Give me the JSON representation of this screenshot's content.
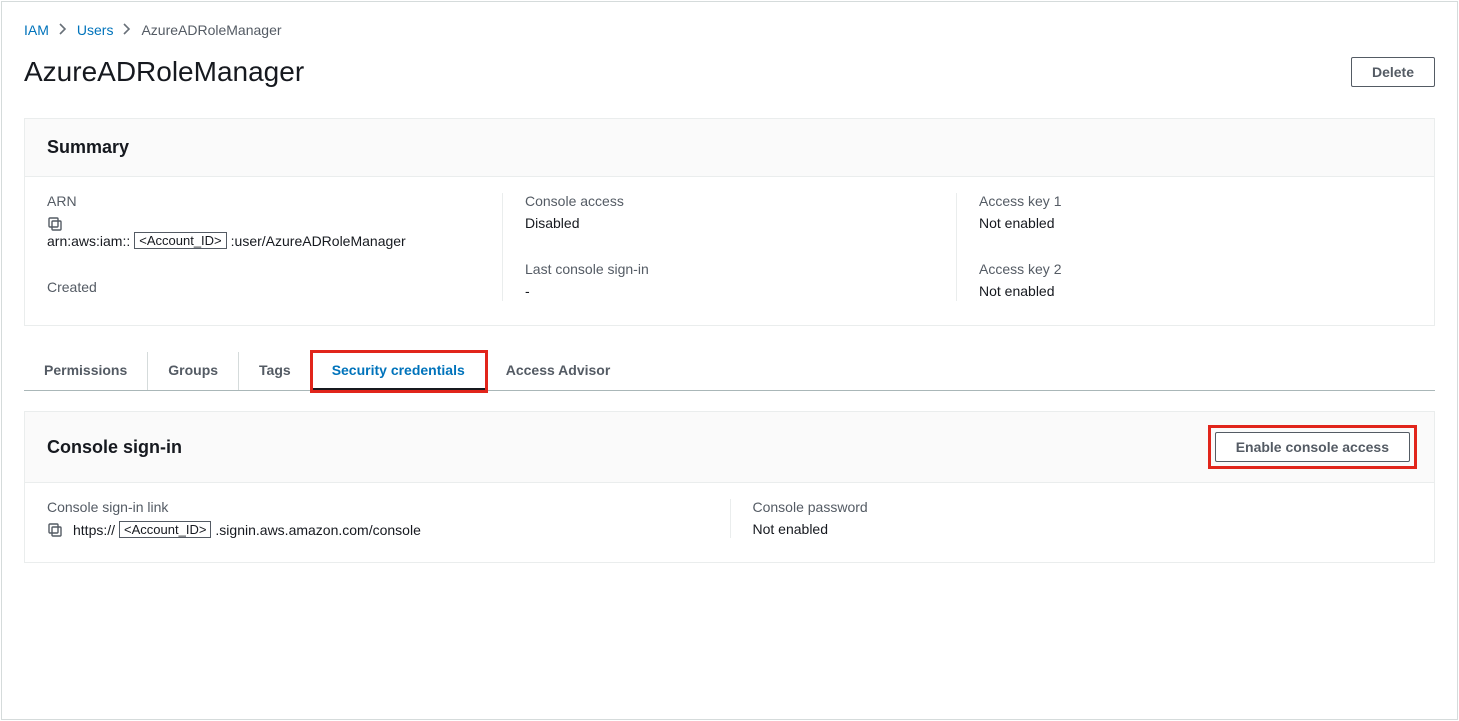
{
  "breadcrumb": {
    "root": "IAM",
    "mid": "Users",
    "current": "AzureADRoleManager"
  },
  "title": "AzureADRoleManager",
  "actions": {
    "delete": "Delete"
  },
  "summary": {
    "heading": "Summary",
    "arn_label": "ARN",
    "arn_prefix": "arn:aws:iam::",
    "arn_account_placeholder": "<Account_ID>",
    "arn_suffix": ":user/AzureADRoleManager",
    "created_label": "Created",
    "created_value": "",
    "console_access_label": "Console access",
    "console_access_value": "Disabled",
    "last_signin_label": "Last console sign-in",
    "last_signin_value": "-",
    "access_key1_label": "Access key 1",
    "access_key1_value": "Not enabled",
    "access_key2_label": "Access key 2",
    "access_key2_value": "Not enabled"
  },
  "tabs": {
    "permissions": "Permissions",
    "groups": "Groups",
    "tags": "Tags",
    "security": "Security credentials",
    "advisor": "Access Advisor"
  },
  "console_signin": {
    "heading": "Console sign-in",
    "enable_button": "Enable console access",
    "link_label": "Console sign-in link",
    "link_prefix": "https://",
    "link_account_placeholder": "<Account_ID>",
    "link_suffix": ".signin.aws.amazon.com/console",
    "password_label": "Console password",
    "password_value": "Not enabled"
  }
}
